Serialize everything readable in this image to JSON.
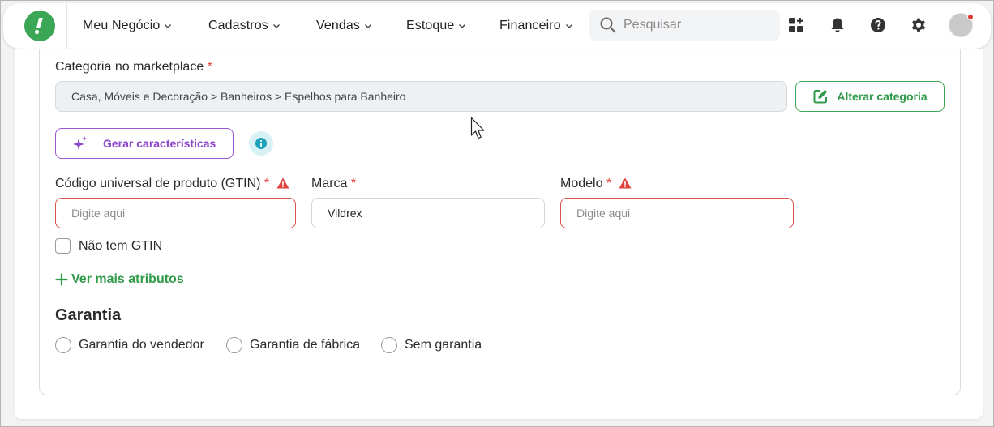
{
  "nav": {
    "items": [
      {
        "label": "Meu Negócio"
      },
      {
        "label": "Cadastros"
      },
      {
        "label": "Vendas"
      },
      {
        "label": "Estoque"
      },
      {
        "label": "Financeiro"
      }
    ],
    "search_placeholder": "Pesquisar"
  },
  "colors": {
    "brand_green": "#3ba655",
    "accent_purple": "#8b45c9",
    "error_red": "#e0413a"
  },
  "form": {
    "category_label": "Categoria no marketplace",
    "required_mark": "*",
    "category_value": "Casa, Móveis e Decoração > Banheiros > Espelhos para Banheiro",
    "change_category_button": "Alterar categoria",
    "generate_features_button": "Gerar características",
    "gtin_label": "Código universal de produto (GTIN)",
    "gtin_placeholder": "Digite aqui",
    "brand_label": "Marca",
    "brand_value": "Vildrex",
    "model_label": "Modelo",
    "model_placeholder": "Digite aqui",
    "no_gtin_label": "Não tem GTIN",
    "more_attributes_link": "Ver mais atributos",
    "warranty_title": "Garantia",
    "warranty_options": [
      {
        "label": "Garantia do vendedor"
      },
      {
        "label": "Garantia de fábrica"
      },
      {
        "label": "Sem garantia"
      }
    ]
  }
}
